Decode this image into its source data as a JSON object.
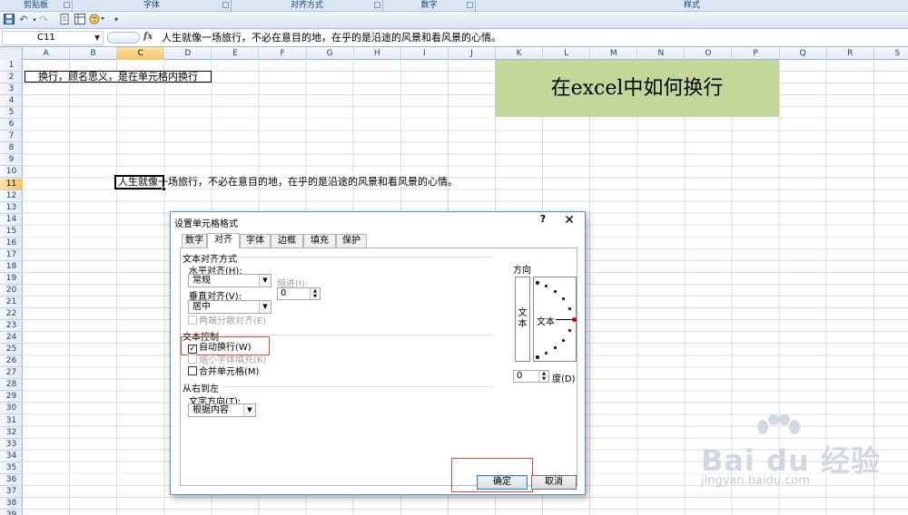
{
  "ribbon": {
    "groups": [
      "剪贴板",
      "字体",
      "对齐方式",
      "数字",
      "样式"
    ]
  },
  "qat": {
    "icons": [
      "save-icon",
      "undo-icon",
      "redo-icon",
      "print-icon",
      "view-icon",
      "customize-icon"
    ]
  },
  "formula_bar": {
    "name_box": "C11",
    "fx_label": "fx",
    "content": "人生就像一场旅行，不必在意目的地，在乎的是沿途的风景和看风景的心情。"
  },
  "grid": {
    "columns": [
      "A",
      "B",
      "C",
      "D",
      "E",
      "F",
      "G",
      "H",
      "I",
      "J",
      "K",
      "L",
      "M",
      "N",
      "O",
      "P",
      "Q",
      "R",
      "S"
    ],
    "active_column": "C",
    "rows": [
      "1",
      "2",
      "3",
      "4",
      "5",
      "6",
      "7",
      "8",
      "9",
      "10",
      "11",
      "12",
      "13",
      "14",
      "15",
      "16",
      "17",
      "18",
      "19",
      "20",
      "21",
      "22",
      "23",
      "24",
      "25",
      "26",
      "27",
      "28",
      "29",
      "30",
      "31",
      "32",
      "33",
      "34",
      "35",
      "36",
      "37",
      "38",
      "39"
    ],
    "active_row": "11",
    "cell_b2_text": "换行，顾名思义，是在单元格内换行",
    "title_text": "在excel中如何换行",
    "cell_c11_text": "人生就像一场旅行，不必在意目的地，在乎的是沿途的风景和看风景的心情。"
  },
  "dialog": {
    "title": "设置单元格格式",
    "help": "?",
    "close": "✕",
    "tabs": [
      "数字",
      "对齐",
      "字体",
      "边框",
      "填充",
      "保护"
    ],
    "active_tab": "对齐",
    "text_alignment_section": "文本对齐方式",
    "horizontal_label": "水平对齐(H):",
    "horizontal_value": "常规",
    "indent_label": "缩进(I):",
    "indent_value": "0",
    "vertical_label": "垂直对齐(V):",
    "vertical_value": "居中",
    "distributed_label": "两端分散对齐(E)",
    "text_control_section": "文本控制",
    "wrap_text_label": "自动换行(W)",
    "wrap_text_checked": true,
    "shrink_label": "缩小字体填充(K)",
    "merge_label": "合并单元格(M)",
    "rtl_section": "从右到左",
    "direction_label": "文字方向(T):",
    "direction_value": "根据内容",
    "orientation_label": "方向",
    "orientation_vertical_text": "文本",
    "orientation_dial_text": "文本",
    "degree_value": "0",
    "degree_label": "度(D)",
    "ok_label": "确定",
    "cancel_label": "取消"
  },
  "watermark": {
    "brand": "Bai du 经验",
    "url": "jingyan.baidu.com"
  },
  "colors": {
    "title_fill": "#c4d79b",
    "highlight_red": "#d84a4a",
    "header_active": "#f5c367"
  }
}
